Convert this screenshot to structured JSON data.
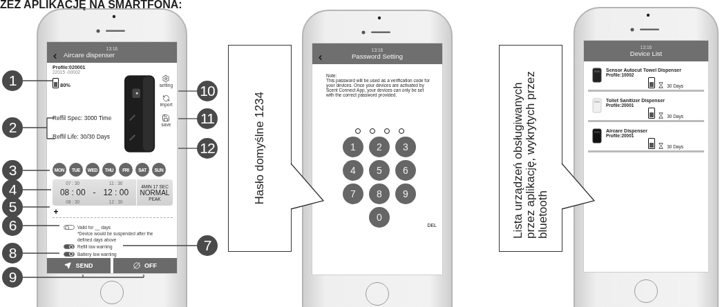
{
  "heading": "ZEZ APLIKACJĘ NA SMARTFONA:",
  "dispenser_screen": {
    "time": "13:16",
    "title": "Aircare dispenser",
    "profile": "Profile:020001",
    "profile_sub": "22015 -00002",
    "battery": {
      "reading": "80%"
    },
    "refill_spec": "Reffil Spec: 3000 Time",
    "refill_life": "Reffil Life: 30/30 Days",
    "side_actions": [
      {
        "kind": "setting",
        "label": "setting"
      },
      {
        "kind": "import",
        "label": "import"
      },
      {
        "kind": "save",
        "label": "save"
      }
    ],
    "days": [
      "MON",
      "TUE",
      "WED",
      "THU",
      "FRI",
      "SAT",
      "SUN"
    ],
    "schedule": {
      "prev_start": "07 : 30",
      "prev_end": "11 : 30",
      "start": "08 : 00",
      "separator": "-",
      "end": "12 : 00",
      "next_start": "08 : 30",
      "next_end": "12 : 30",
      "duration": "4MIN 17 SEC",
      "mode": "NORMAL",
      "peak": "PEAK"
    },
    "add": "+",
    "toggles": [
      {
        "label": "Valid for __ days",
        "note": "*Device would be suspended after the defined days above",
        "on": false
      },
      {
        "label": "Refill low warning",
        "on": true
      },
      {
        "label": "Battery low warning",
        "on": true
      }
    ],
    "buttons": [
      {
        "kind": "send",
        "label": "SEND"
      },
      {
        "kind": "off",
        "label": "OFF"
      }
    ]
  },
  "markers": [
    "1",
    "2",
    "3",
    "4",
    "5",
    "6",
    "8",
    "9",
    "10",
    "11",
    "12",
    "7"
  ],
  "callouts": [
    {
      "text": "Hasło domyślne 1234"
    },
    {
      "text": "Lista urządzeń obsługiwanych przez aplikację, wykrytych przez bluetooth"
    }
  ],
  "password_screen": {
    "time": "13:16",
    "title": "Password Setting",
    "note_title": "Note:",
    "note": "This password will be used as a verification code for your devices. Once your devices are activated by Scent Connect App, your devices can only be set with the correct password provided.",
    "keys": [
      "1",
      "2",
      "3",
      "4",
      "5",
      "6",
      "7",
      "8",
      "9",
      "0"
    ],
    "delete": "DEL"
  },
  "device_list_screen": {
    "time": "13:16",
    "title": "Device List",
    "devices": [
      {
        "kind": "towel",
        "name": "Sensor Autocut Towel Dispenser",
        "profile": "Profile:10002",
        "days": "30 Days"
      },
      {
        "kind": "sanitizer",
        "name": "Toliet Sanitizer Dispenser",
        "profile": "Profile:20001",
        "days": "30 Days"
      },
      {
        "kind": "aircare",
        "name": "Aircare Dispenser",
        "profile": "Profile:20001",
        "days": "30 Days"
      }
    ]
  }
}
